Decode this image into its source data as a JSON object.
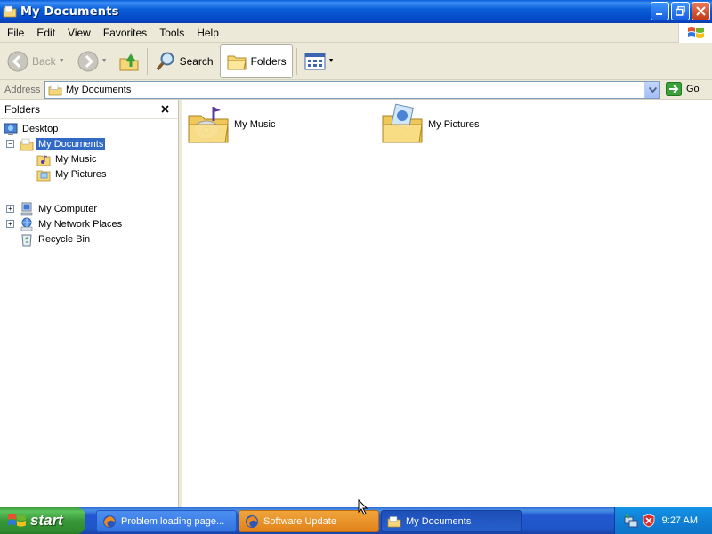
{
  "window": {
    "title": "My Documents"
  },
  "menu": {
    "items": [
      "File",
      "Edit",
      "View",
      "Favorites",
      "Tools",
      "Help"
    ]
  },
  "toolbar": {
    "back_label": "Back",
    "search_label": "Search",
    "folders_label": "Folders"
  },
  "address": {
    "label": "Address",
    "value": "My Documents",
    "go_label": "Go"
  },
  "folders_pane": {
    "title": "Folders",
    "tree": [
      {
        "label": "Desktop",
        "icon": "desktop-icon"
      },
      {
        "label": "My Documents",
        "icon": "my-documents-icon",
        "selected": true,
        "expanded": true
      },
      {
        "label": "My Music",
        "icon": "music-folder-icon"
      },
      {
        "label": "My Pictures",
        "icon": "pictures-folder-icon"
      },
      {
        "label": "My Computer",
        "icon": "computer-icon",
        "expanded": false
      },
      {
        "label": "My Network Places",
        "icon": "network-icon",
        "expanded": false
      },
      {
        "label": "Recycle Bin",
        "icon": "recycle-bin-icon"
      }
    ]
  },
  "content": {
    "items": [
      {
        "label": "My Music",
        "icon": "music-folder-icon"
      },
      {
        "label": "My Pictures",
        "icon": "pictures-folder-icon"
      }
    ]
  },
  "taskbar": {
    "start_label": "start",
    "tasks": [
      {
        "label": "Problem loading page...",
        "state": "normal"
      },
      {
        "label": "Software Update",
        "state": "flash"
      },
      {
        "label": "My Documents",
        "state": "active"
      }
    ],
    "clock": "9:27 AM"
  },
  "colors": {
    "titlebar": "#0a5fd8",
    "selection": "#316ac5",
    "chrome": "#ece9d8",
    "taskbar": "#2358d0",
    "start": "#389838",
    "flash_task": "#e2831a"
  }
}
